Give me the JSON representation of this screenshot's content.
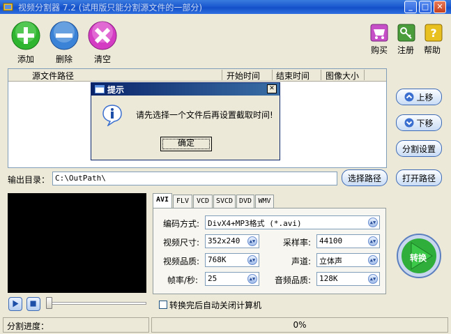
{
  "window": {
    "title": "视频分割器 7.2 (试用版只能分割源文件的一部分)",
    "controls": {
      "minimize": "_",
      "maximize": "□",
      "close": "✕"
    }
  },
  "toolbar": {
    "add_label": "添加",
    "delete_label": "删除",
    "clear_label": "清空",
    "buy_label": "购买",
    "register_label": "注册",
    "help_label": "帮助"
  },
  "file_list": {
    "columns": [
      "源文件路径",
      "开始时间",
      "结束时间",
      "图像大小"
    ]
  },
  "side_buttons": {
    "move_up": "上移",
    "move_down": "下移",
    "split_settings": "分割设置",
    "open_path": "打开路径"
  },
  "output": {
    "label": "输出目录：",
    "path": "C:\\OutPath\\",
    "choose_path": "选择路径"
  },
  "tabs": [
    "AVI",
    "FLV",
    "VCD",
    "SVCD",
    "DVD",
    "WMV"
  ],
  "settings": {
    "encoding_label": "编码方式:",
    "encoding_value": "DivX4+MP3格式 (*.avi)",
    "size_label": "视频尺寸:",
    "size_value": "352x240",
    "sample_rate_label": "采样率:",
    "sample_rate_value": "44100",
    "video_quality_label": "视频品质:",
    "video_quality_value": "768K",
    "channel_label": "声道:",
    "channel_value": "立体声",
    "fps_label": "帧率/秒:",
    "fps_value": "25",
    "audio_quality_label": "音频品质:",
    "audio_quality_value": "128K"
  },
  "convert_label": "转换",
  "auto_shutdown_label": "转换完后自动关闭计算机",
  "status": {
    "progress_label": "分割进度：",
    "progress_text": "0%",
    "progress_value": 0
  },
  "dialog": {
    "title": "提示",
    "message": "请先选择一个文件后再设置截取时间!",
    "ok_label": "确定",
    "close": "✕"
  },
  "colors": {
    "accent": "#1c5ad0",
    "add_green": "#2fb52f",
    "delete_blue": "#3b83d6",
    "clear_magenta": "#d43cc4"
  }
}
